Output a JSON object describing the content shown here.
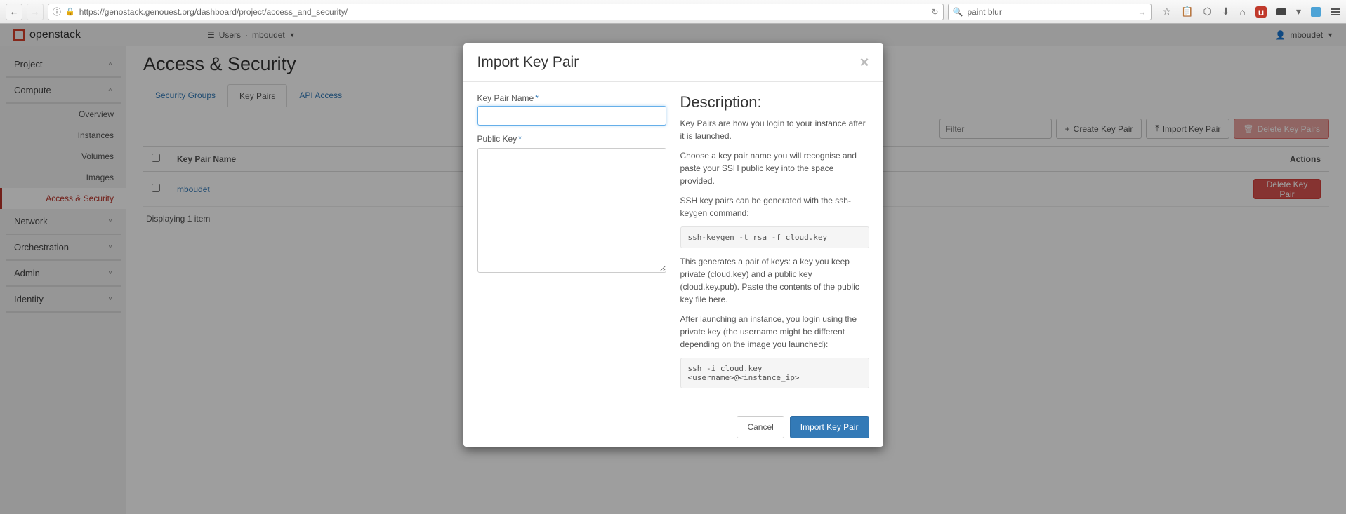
{
  "browser": {
    "url": "https://genostack.genouest.org/dashboard/project/access_and_security/",
    "search": "paint blur"
  },
  "topbar": {
    "logo": "openstack",
    "project_label": "Users",
    "project_value": "mboudet",
    "user": "mboudet"
  },
  "sidebar": {
    "groups": [
      {
        "label": "Project",
        "expanded": true
      },
      {
        "label": "Compute",
        "expanded": true,
        "items": [
          "Overview",
          "Instances",
          "Volumes",
          "Images",
          "Access & Security"
        ],
        "active": "Access & Security"
      },
      {
        "label": "Network",
        "expanded": false
      },
      {
        "label": "Orchestration",
        "expanded": false
      },
      {
        "label": "Admin",
        "expanded": false
      },
      {
        "label": "Identity",
        "expanded": false
      }
    ]
  },
  "page": {
    "title": "Access & Security",
    "tabs": [
      "Security Groups",
      "Key Pairs",
      "API Access"
    ],
    "active_tab": "Key Pairs",
    "filter_placeholder": "Filter",
    "buttons": {
      "create": "Create Key Pair",
      "import": "Import Key Pair",
      "delete_all": "Delete Key Pairs"
    },
    "table": {
      "columns": [
        "",
        "Key Pair Name",
        "Actions"
      ],
      "rows": [
        {
          "name": "mboudet",
          "action": "Delete Key Pair"
        }
      ],
      "footer": "Displaying 1 item"
    }
  },
  "modal": {
    "title": "Import Key Pair",
    "name_label": "Key Pair Name",
    "pubkey_label": "Public Key",
    "desc_heading": "Description:",
    "p1": "Key Pairs are how you login to your instance after it is launched.",
    "p2": "Choose a key pair name you will recognise and paste your SSH public key into the space provided.",
    "p3": "SSH key pairs can be generated with the ssh-keygen command:",
    "cmd1": "ssh-keygen -t rsa -f cloud.key",
    "p4": "This generates a pair of keys: a key you keep private (cloud.key) and a public key (cloud.key.pub). Paste the contents of the public key file here.",
    "p5": "After launching an instance, you login using the private key (the username might be different depending on the image you launched):",
    "cmd2": "ssh -i cloud.key <username>@<instance_ip>",
    "cancel": "Cancel",
    "submit": "Import Key Pair"
  }
}
